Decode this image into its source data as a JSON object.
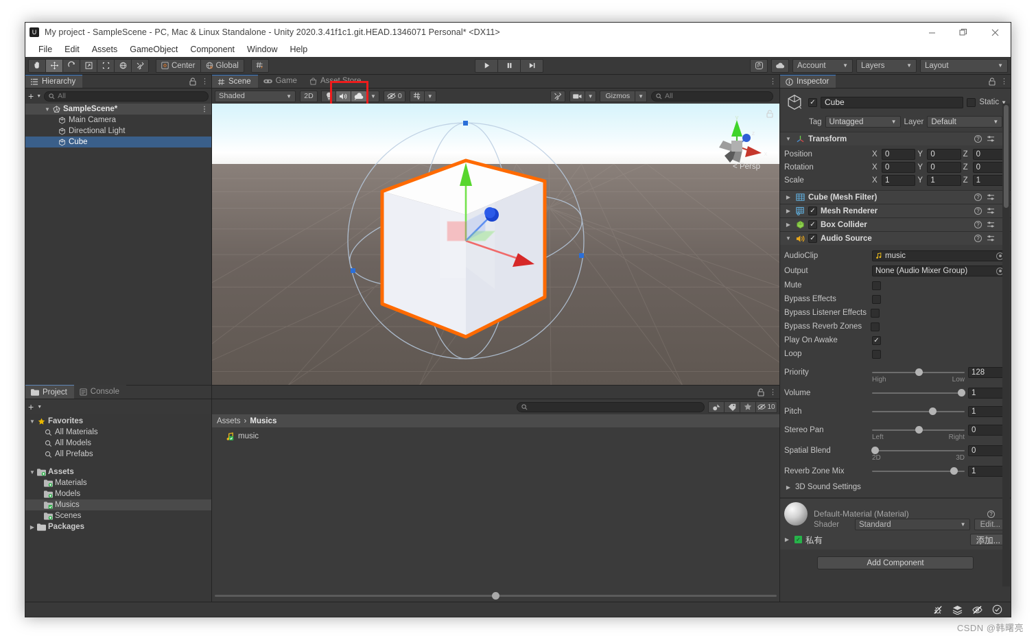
{
  "window": {
    "title": "My project - SampleScene - PC, Mac & Linux Standalone - Unity 2020.3.41f1c1.git.HEAD.1346071 Personal* <DX11>",
    "minimize": "—",
    "maximize": "❐",
    "close": "✕"
  },
  "menu": {
    "items": [
      "File",
      "Edit",
      "Assets",
      "GameObject",
      "Component",
      "Window",
      "Help"
    ]
  },
  "toolbar": {
    "tools": [
      {
        "name": "hand-tool",
        "glyph": "✋",
        "active": false
      },
      {
        "name": "move-tool",
        "glyph": "✥",
        "active": true
      },
      {
        "name": "rotate-tool",
        "glyph": "↺",
        "active": false
      },
      {
        "name": "scale-tool",
        "glyph": "⤢",
        "active": false
      },
      {
        "name": "rect-tool",
        "glyph": "⬚",
        "active": false
      },
      {
        "name": "transform-tool",
        "glyph": "✪",
        "active": false
      },
      {
        "name": "custom-tool",
        "glyph": "⚒",
        "active": false
      }
    ],
    "pivot_label": "Center",
    "space_label": "Global",
    "grid_snap_glyph": "⌗",
    "play": "▶",
    "pause": "❚❚",
    "step": "▶❙",
    "collab_icon": "⬡",
    "cloud_icon": "☁",
    "account_label": "Account",
    "layers_label": "Layers",
    "layout_label": "Layout"
  },
  "hierarchy": {
    "tab_label": "Hierarchy",
    "search_placeholder": "All",
    "plus_label": "+",
    "items": [
      {
        "label": "SampleScene*",
        "type": "scene",
        "depth": 0,
        "selected": false
      },
      {
        "label": "Main Camera",
        "type": "gameobject",
        "depth": 1,
        "selected": false
      },
      {
        "label": "Directional Light",
        "type": "gameobject",
        "depth": 1,
        "selected": false
      },
      {
        "label": "Cube",
        "type": "gameobject",
        "depth": 1,
        "selected": true
      }
    ]
  },
  "scene": {
    "tabs": [
      {
        "label": "Scene",
        "icon": "grid-icon",
        "active": true
      },
      {
        "label": "Game",
        "icon": "gamepad-icon",
        "active": false
      },
      {
        "label": "Asset Store",
        "icon": "store-icon",
        "active": false
      }
    ],
    "shading_mode": "Shaded",
    "mode_2d_label": "2D",
    "lighting_icon": "💡",
    "audio_icon": "🔊",
    "fx_icon": "☁",
    "hidden_count": "0",
    "grid_icon": "⌗",
    "gizmos_label": "Gizmos",
    "search_placeholder": "All",
    "camera_icon": "🎥",
    "tools_icon": "⚒",
    "persp_label": "< Persp",
    "axis_x": "x",
    "axis_y": "y",
    "axis_z": "z",
    "highlight_color": "#ee1c1c",
    "selection_outline_color": "#ff6a00"
  },
  "project": {
    "tabs": [
      {
        "label": "Project",
        "icon": "folder-icon",
        "active": true
      },
      {
        "label": "Console",
        "icon": "console-icon",
        "active": false
      }
    ],
    "search_placeholder": "",
    "hidden_count": "10",
    "tree": [
      {
        "label": "Favorites",
        "depth": 0,
        "icon": "star-icon",
        "expanded": true,
        "bold": true
      },
      {
        "label": "All Materials",
        "depth": 1,
        "icon": "search-icon"
      },
      {
        "label": "All Models",
        "depth": 1,
        "icon": "search-icon"
      },
      {
        "label": "All Prefabs",
        "depth": 1,
        "icon": "search-icon"
      },
      {
        "label": "Assets",
        "depth": 0,
        "icon": "folder-plus-icon",
        "expanded": true,
        "bold": true
      },
      {
        "label": "Materials",
        "depth": 1,
        "icon": "folder-plus-icon"
      },
      {
        "label": "Models",
        "depth": 1,
        "icon": "folder-plus-icon"
      },
      {
        "label": "Musics",
        "depth": 1,
        "icon": "folder-check-icon",
        "selected": true
      },
      {
        "label": "Scenes",
        "depth": 1,
        "icon": "folder-plus-icon"
      },
      {
        "label": "Packages",
        "depth": 0,
        "icon": "folder-icon",
        "expanded": false,
        "bold": true
      }
    ],
    "breadcrumb": [
      "Assets",
      "Musics"
    ],
    "assets": [
      {
        "label": "music",
        "icon": "audio-clip-icon"
      }
    ]
  },
  "inspector": {
    "tab_label": "Inspector",
    "object_name": "Cube",
    "object_enabled": true,
    "static_label": "Static",
    "tag_label": "Tag",
    "tag_value": "Untagged",
    "layer_label": "Layer",
    "layer_value": "Default",
    "components": [
      {
        "name": "Transform",
        "icon": "transform-icon",
        "expanded": true,
        "has_checkbox": false,
        "rows": [
          {
            "label": "Position",
            "x": "0",
            "y": "0",
            "z": "0"
          },
          {
            "label": "Rotation",
            "x": "0",
            "y": "0",
            "z": "0"
          },
          {
            "label": "Scale",
            "x": "1",
            "y": "1",
            "z": "1"
          }
        ]
      },
      {
        "name": "Cube (Mesh Filter)",
        "icon": "mesh-filter-icon",
        "expanded": false,
        "has_checkbox": false
      },
      {
        "name": "Mesh Renderer",
        "icon": "mesh-renderer-icon",
        "expanded": false,
        "has_checkbox": true,
        "checked": true
      },
      {
        "name": "Box Collider",
        "icon": "box-collider-icon",
        "expanded": false,
        "has_checkbox": true,
        "checked": true
      },
      {
        "name": "Audio Source",
        "icon": "audio-source-icon",
        "expanded": true,
        "has_checkbox": true,
        "checked": true
      }
    ],
    "audio_source": {
      "audioclip_label": "AudioClip",
      "audioclip_value": "music",
      "output_label": "Output",
      "output_value": "None (Audio Mixer Group)",
      "toggles": [
        {
          "label": "Mute",
          "checked": false
        },
        {
          "label": "Bypass Effects",
          "checked": false
        },
        {
          "label": "Bypass Listener Effects",
          "checked": false
        },
        {
          "label": "Bypass Reverb Zones",
          "checked": false
        },
        {
          "label": "Play On Awake",
          "checked": true
        },
        {
          "label": "Loop",
          "checked": false
        }
      ],
      "sliders": [
        {
          "label": "Priority",
          "value": "128",
          "pct": 50,
          "min_label": "High",
          "max_label": "Low"
        },
        {
          "label": "Volume",
          "value": "1",
          "pct": 100,
          "min_label": "",
          "max_label": ""
        },
        {
          "label": "Pitch",
          "value": "1",
          "pct": 65,
          "min_label": "",
          "max_label": ""
        },
        {
          "label": "Stereo Pan",
          "value": "0",
          "pct": 50,
          "min_label": "Left",
          "max_label": "Right"
        },
        {
          "label": "Spatial Blend",
          "value": "0",
          "pct": 0,
          "min_label": "2D",
          "max_label": "3D"
        },
        {
          "label": "Reverb Zone Mix",
          "value": "1",
          "pct": 88,
          "min_label": "",
          "max_label": ""
        }
      ],
      "sound_settings_label": "3D Sound Settings"
    },
    "material": {
      "title": "Default-Material (Material)",
      "shader_label": "Shader",
      "shader_value": "Standard",
      "edit_label": "Edit...",
      "private_label": "私有",
      "add_label": "添加..."
    },
    "add_component_label": "Add Component"
  },
  "statusbar": {
    "icons": [
      "bug-off-icon",
      "layers-icon",
      "eye-off-icon",
      "check-circle-icon"
    ]
  },
  "watermark": "CSDN @韩曙亮"
}
